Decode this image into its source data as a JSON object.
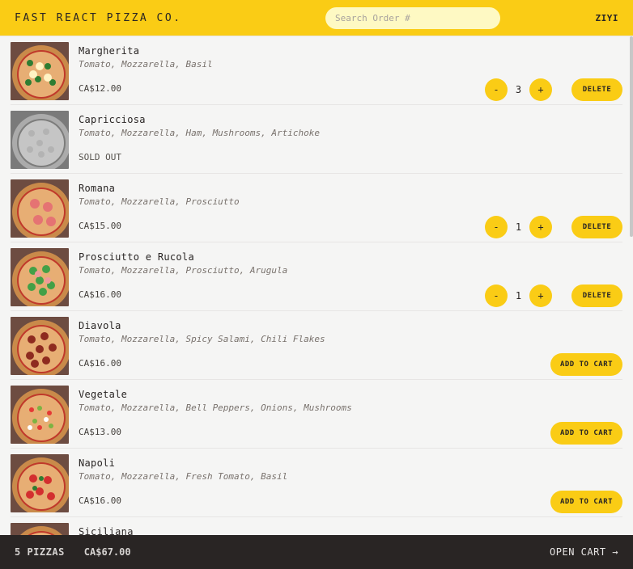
{
  "header": {
    "logo": "Fast React Pizza Co.",
    "search_placeholder": "Search Order #",
    "username": "ZIYI"
  },
  "menu": [
    {
      "name": "Margherita",
      "ingredients": "Tomato, Mozzarella, Basil",
      "price": "CA$12.00",
      "state": "in-cart",
      "qty": "3",
      "topping": "basil"
    },
    {
      "name": "Capricciosa",
      "ingredients": "Tomato, Mozzarella, Ham, Mushrooms, Artichoke",
      "price": "Sold out",
      "state": "sold-out",
      "topping": "mushroom"
    },
    {
      "name": "Romana",
      "ingredients": "Tomato, Mozzarella, Prosciutto",
      "price": "CA$15.00",
      "state": "in-cart",
      "qty": "1",
      "topping": "prosciutto"
    },
    {
      "name": "Prosciutto e Rucola",
      "ingredients": "Tomato, Mozzarella, Prosciutto, Arugula",
      "price": "CA$16.00",
      "state": "in-cart",
      "qty": "1",
      "topping": "arugula"
    },
    {
      "name": "Diavola",
      "ingredients": "Tomato, Mozzarella, Spicy Salami, Chili Flakes",
      "price": "CA$16.00",
      "state": "available",
      "topping": "salami"
    },
    {
      "name": "Vegetale",
      "ingredients": "Tomato, Mozzarella, Bell Peppers, Onions, Mushrooms",
      "price": "CA$13.00",
      "state": "available",
      "topping": "veg"
    },
    {
      "name": "Napoli",
      "ingredients": "Tomato, Mozzarella, Fresh Tomato, Basil",
      "price": "CA$16.00",
      "state": "available",
      "topping": "tomato"
    },
    {
      "name": "Siciliana",
      "ingredients": "",
      "price": "",
      "state": "cut",
      "topping": "basil"
    }
  ],
  "labels": {
    "decrease": "-",
    "increase": "+",
    "delete": "Delete",
    "add_to_cart": "Add to cart"
  },
  "footer": {
    "count": "5 pizzas",
    "total": "CA$67.00",
    "open_cart": "Open cart →"
  },
  "colors": {
    "accent": "#facc15",
    "footer_bg": "#292524",
    "page_bg": "#f5f5f4"
  }
}
